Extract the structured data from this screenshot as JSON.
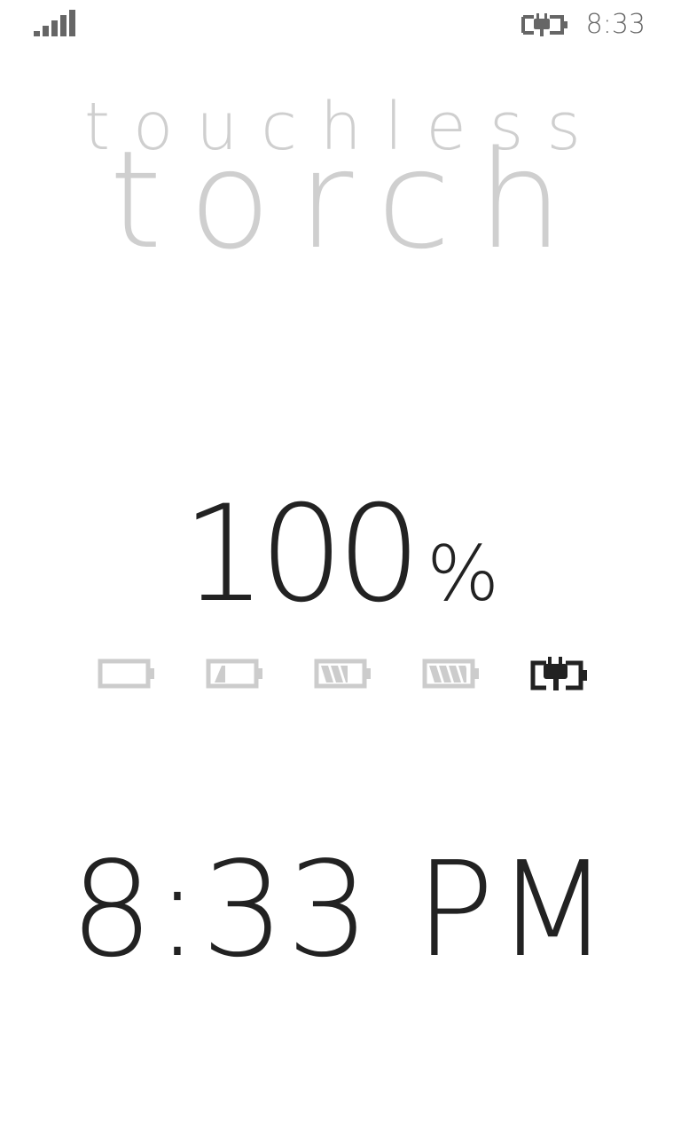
{
  "status_bar": {
    "signal_icon": "signal-strength-icon",
    "battery_icon": "battery-charging-icon",
    "time": "8:33"
  },
  "logo": {
    "line1": "touchless",
    "line2": "torch"
  },
  "battery": {
    "percent": "100",
    "percent_sign": "%",
    "levels": [
      {
        "icon": "battery-empty-icon",
        "state": "inactive"
      },
      {
        "icon": "battery-low-icon",
        "state": "inactive"
      },
      {
        "icon": "battery-medium-icon",
        "state": "inactive"
      },
      {
        "icon": "battery-high-icon",
        "state": "inactive"
      },
      {
        "icon": "battery-charging-icon",
        "state": "active"
      }
    ]
  },
  "clock": {
    "time": "8:33 PM"
  },
  "colors": {
    "background": "#ffffff",
    "logo": "#cfcfcf",
    "primary_text": "#222222",
    "inactive_icon": "#cccccc",
    "status_text": "#666666"
  }
}
